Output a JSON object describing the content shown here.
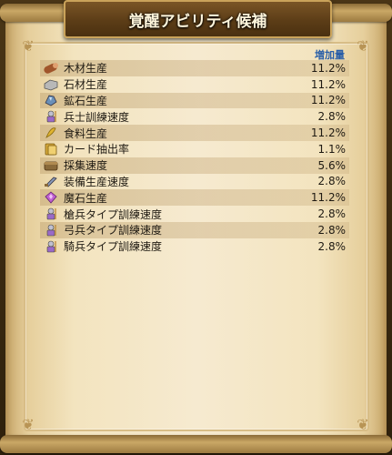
{
  "title": "覚醒アビリティ候補",
  "column_header": "増加量",
  "rows": [
    {
      "icon": "wood-log-icon",
      "name": "木材生産",
      "value": "11.2%",
      "color": "#a0552b"
    },
    {
      "icon": "stone-block-icon",
      "name": "石材生産",
      "value": "11.2%",
      "color": "#b8b8b8"
    },
    {
      "icon": "ore-icon",
      "name": "鉱石生産",
      "value": "11.2%",
      "color": "#6a8fb8"
    },
    {
      "icon": "soldier-icon",
      "name": "兵士訓練速度",
      "value": "2.8%",
      "color": "#9a6ac8"
    },
    {
      "icon": "food-icon",
      "name": "食料生産",
      "value": "11.2%",
      "color": "#e0b430"
    },
    {
      "icon": "card-icon",
      "name": "カード抽出率",
      "value": "1.1%",
      "color": "#d4a83a"
    },
    {
      "icon": "gather-icon",
      "name": "採集速度",
      "value": "5.6%",
      "color": "#8a6a3a"
    },
    {
      "icon": "equipment-icon",
      "name": "装備生産速度",
      "value": "2.8%",
      "color": "#8a9ab8"
    },
    {
      "icon": "magic-stone-icon",
      "name": "魔石生産",
      "value": "11.2%",
      "color": "#c060d0"
    },
    {
      "icon": "spearman-icon",
      "name": "槍兵タイプ訓練速度",
      "value": "2.8%",
      "color": "#9a6ac8"
    },
    {
      "icon": "archer-icon",
      "name": "弓兵タイプ訓練速度",
      "value": "2.8%",
      "color": "#9a6ac8"
    },
    {
      "icon": "cavalry-icon",
      "name": "騎兵タイプ訓練速度",
      "value": "2.8%",
      "color": "#9a6ac8"
    }
  ]
}
